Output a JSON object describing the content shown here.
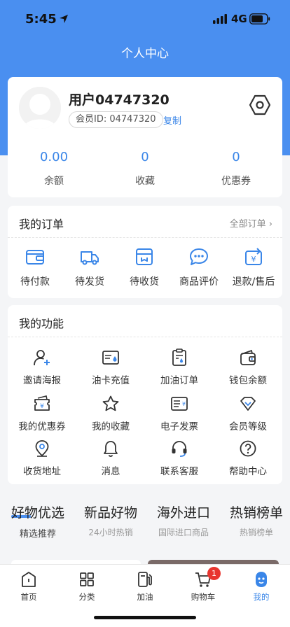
{
  "status_bar": {
    "time": "5:45",
    "network": "4G"
  },
  "page_title": "个人中心",
  "profile": {
    "username": "用户04747320",
    "member_id": "会员ID: 04747320",
    "copy_label": "复制",
    "stats": [
      {
        "value": "0.00",
        "label": "余额"
      },
      {
        "value": "0",
        "label": "收藏"
      },
      {
        "value": "0",
        "label": "优惠券"
      }
    ]
  },
  "orders": {
    "title": "我的订单",
    "all_label": "全部订单",
    "items": [
      {
        "label": "待付款",
        "icon": "wallet-icon"
      },
      {
        "label": "待发货",
        "icon": "truck-icon"
      },
      {
        "label": "待收货",
        "icon": "package-icon"
      },
      {
        "label": "商品评价",
        "icon": "comment-icon"
      },
      {
        "label": "退款/售后",
        "icon": "refund-icon"
      }
    ]
  },
  "functions": {
    "title": "我的功能",
    "items": [
      {
        "label": "邀请海报",
        "icon": "invite-user-icon"
      },
      {
        "label": "油卡充值",
        "icon": "fuel-card-icon"
      },
      {
        "label": "加油订单",
        "icon": "fuel-order-icon"
      },
      {
        "label": "钱包余额",
        "icon": "wallet-icon"
      },
      {
        "label": "我的优惠券",
        "icon": "coupon-icon"
      },
      {
        "label": "我的收藏",
        "icon": "star-icon"
      },
      {
        "label": "电子发票",
        "icon": "invoice-icon"
      },
      {
        "label": "会员等级",
        "icon": "diamond-icon"
      },
      {
        "label": "收货地址",
        "icon": "location-pin-icon"
      },
      {
        "label": "消息",
        "icon": "bell-icon"
      },
      {
        "label": "联系客服",
        "icon": "headset-icon"
      },
      {
        "label": "帮助中心",
        "icon": "help-icon"
      }
    ]
  },
  "categories": [
    {
      "name": "好物优选",
      "sub": "精选推荐"
    },
    {
      "name": "新品好物",
      "sub": "24小时热销"
    },
    {
      "name": "海外进口",
      "sub": "国际进口商品"
    },
    {
      "name": "热销榜单",
      "sub": "热销榜单"
    }
  ],
  "tabbar": {
    "items": [
      {
        "label": "首页",
        "icon": "home-icon"
      },
      {
        "label": "分类",
        "icon": "grid-icon"
      },
      {
        "label": "加油",
        "icon": "fuel-pump-icon"
      },
      {
        "label": "购物车",
        "icon": "cart-icon",
        "badge": "1"
      },
      {
        "label": "我的",
        "icon": "profile-icon"
      }
    ]
  },
  "colors": {
    "primary": "#4a8ff0",
    "accent_text": "#3a86e8",
    "badge": "#e8352f"
  }
}
